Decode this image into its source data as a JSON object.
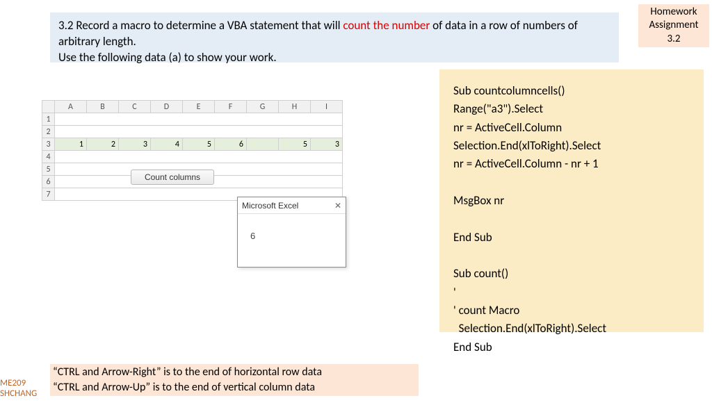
{
  "banner": {
    "prefix": "3.2 Record a macro to determine a VBA statement that will ",
    "highlight": "count the number",
    "suffix": " of data in a row of numbers of arbitrary length.",
    "line2": "Use the following data (a) to show your work."
  },
  "hw_badge": {
    "line1": "Homework",
    "line2": "Assignment",
    "line3": "3.2"
  },
  "sheet": {
    "columns": [
      "A",
      "B",
      "C",
      "D",
      "E",
      "F",
      "G",
      "H",
      "I"
    ],
    "rows": [
      "1",
      "2",
      "3",
      "4",
      "5",
      "6",
      "7"
    ],
    "data_row_index": 2,
    "row3": [
      "1",
      "2",
      "3",
      "4",
      "5",
      "6",
      "",
      "5",
      "3"
    ]
  },
  "chart_data": {
    "type": "table",
    "title": "Excel row 3 values",
    "categories": [
      "A",
      "B",
      "C",
      "D",
      "E",
      "F",
      "G",
      "H",
      "I"
    ],
    "values": [
      1,
      2,
      3,
      4,
      5,
      6,
      null,
      5,
      3
    ]
  },
  "button": {
    "label": "Count columns"
  },
  "msgbox": {
    "title": "Microsoft Excel",
    "value": "6"
  },
  "code": {
    "l1": "Sub countcolumncells()",
    "l2": "Range(\"a3\").Select",
    "l3": "nr = ActiveCell.Column",
    "l4": "Selection.End(xlToRight).Select",
    "l5": "nr = ActiveCell.Column - nr + 1",
    "l6": "",
    "l7": "MsgBox nr",
    "l8": "",
    "l9": "End Sub",
    "l10": "",
    "l11": "Sub count()",
    "l12": "'",
    "l13": "' count Macro",
    "l14": "  Selection.End(xlToRight).Select",
    "l15": "End Sub"
  },
  "note": {
    "line1": "“CTRL and Arrow-Right” is to the end of horizontal row data",
    "line2": "“CTRL and Arrow-Up” is to the end of vertical column data"
  },
  "footer": {
    "line1": "ME209",
    "line2": "SHCHANG"
  }
}
